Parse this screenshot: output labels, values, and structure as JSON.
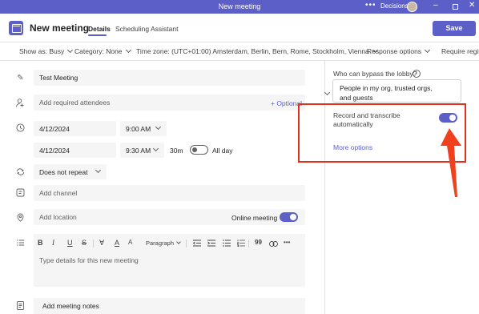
{
  "titlebar": {
    "title": "New meeting",
    "more": "•••",
    "org_label": "Decisions",
    "minimize": "–",
    "close": "✕"
  },
  "header": {
    "title": "New meeting",
    "tabs": [
      "Details",
      "Scheduling Assistant"
    ],
    "save_label": "Save"
  },
  "options": {
    "show_as": "Show as: Busy",
    "category": "Category: None",
    "time_zone": "Time zone: (UTC+01:00) Amsterdam, Berlin, Bern, Rome, Stockholm, Vienna",
    "response": "Response options",
    "require": "Require regis"
  },
  "form": {
    "title_value": "Test Meeting",
    "attendees_placeholder": "Add required attendees",
    "optional_label": "+ Optional",
    "start_date": "4/12/2024",
    "start_time": "9:00 AM",
    "end_date": "4/12/2024",
    "end_time": "9:30 AM",
    "duration": "30m",
    "all_day_label": "All day",
    "all_day": false,
    "repeat": "Does not repeat",
    "channel_placeholder": "Add channel",
    "location_placeholder": "Add location",
    "online_label": "Online meeting",
    "online_meeting": true,
    "paragraph_label": "Paragraph",
    "details_placeholder": "Type details for this new meeting",
    "notes_label": "Add meeting notes"
  },
  "toolbar_icons": [
    "bold-icon",
    "italic-icon",
    "underline-icon",
    "strikethrough-icon",
    "highlight-icon",
    "font-color-icon",
    "font-size-icon",
    "paragraph-dropdown",
    "decrease-indent-icon",
    "increase-indent-icon",
    "bullet-list-icon",
    "numbered-list-icon",
    "quote-icon",
    "link-icon",
    "more-icon"
  ],
  "toolbar_glyphs": {
    "bold": "B",
    "italic": "I",
    "underline": "U",
    "strike": "S",
    "highlight": "∀",
    "font_color": "A",
    "font_size": "A",
    "quote": "99",
    "more": "•••"
  },
  "panel": {
    "lobby_label": "Who can bypass the lobby?",
    "info_glyph": "i",
    "lobby_value": "People in my org, trusted orgs, and guests",
    "record_label": "Record and transcribe automatically",
    "record_on": true,
    "more_options": "More options"
  },
  "colors": {
    "accent": "#5b5fc7",
    "highlight_box": "#e0301e",
    "field_bg": "#f5f5f5"
  }
}
